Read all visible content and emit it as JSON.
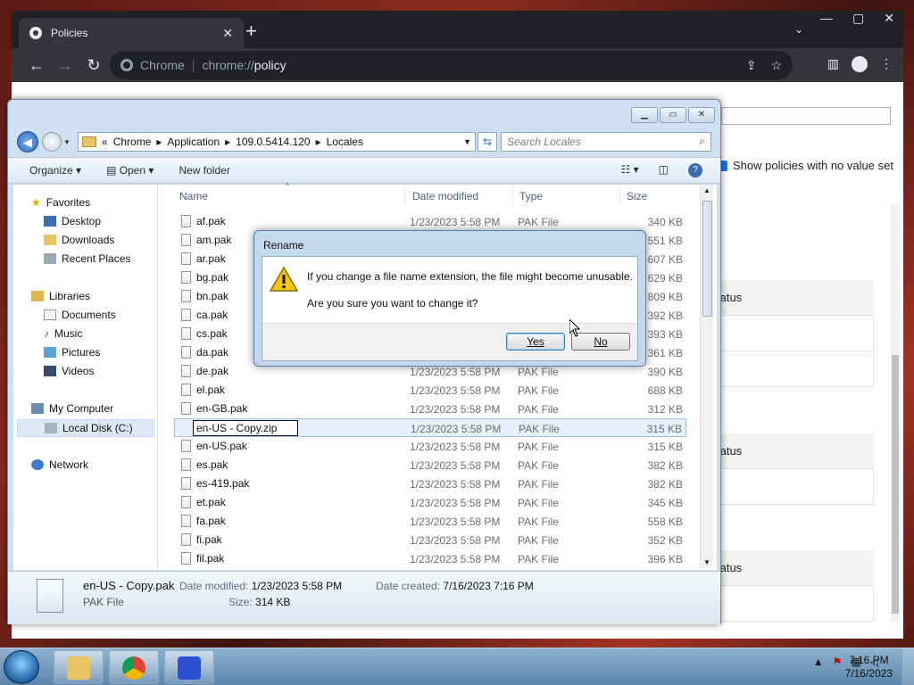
{
  "chrome": {
    "tab_title": "Policies",
    "tab_close": "✕",
    "new_tab": "+",
    "chip": "Chrome",
    "url_prefix": "chrome://",
    "url_path": "policy",
    "show_policies_label": "Show policies with no value set",
    "status_labels": [
      "tatus",
      "tatus",
      "tatus"
    ]
  },
  "explorer": {
    "breadcrumb": [
      "«",
      "Chrome",
      "Application",
      "109.0.5414.120",
      "Locales"
    ],
    "search_placeholder": "Search Locales",
    "commands": {
      "organize": "Organize ▾",
      "open": "Open ▾",
      "new_folder": "New folder"
    },
    "nav": {
      "favorites": "Favorites",
      "desktop": "Desktop",
      "downloads": "Downloads",
      "recent_places": "Recent Places",
      "libraries": "Libraries",
      "documents": "Documents",
      "music": "Music",
      "pictures": "Pictures",
      "videos": "Videos",
      "my_computer": "My Computer",
      "local_disk": "Local Disk (C:)",
      "network": "Network"
    },
    "columns": {
      "name": "Name",
      "date": "Date modified",
      "type": "Type",
      "size": "Size"
    },
    "files": [
      {
        "name": "af.pak",
        "date": "1/23/2023 5:58 PM",
        "type": "PAK File",
        "size": "340 KB"
      },
      {
        "name": "am.pak",
        "date": "",
        "type": "",
        "size": "551 KB"
      },
      {
        "name": "ar.pak",
        "date": "",
        "type": "",
        "size": "607 KB"
      },
      {
        "name": "bg.pak",
        "date": "",
        "type": "",
        "size": "629 KB"
      },
      {
        "name": "bn.pak",
        "date": "",
        "type": "",
        "size": "809 KB"
      },
      {
        "name": "ca.pak",
        "date": "",
        "type": "",
        "size": "392 KB"
      },
      {
        "name": "cs.pak",
        "date": "",
        "type": "",
        "size": "393 KB"
      },
      {
        "name": "da.pak",
        "date": "",
        "type": "",
        "size": "361 KB"
      },
      {
        "name": "de.pak",
        "date": "1/23/2023 5:58 PM",
        "type": "PAK File",
        "size": "390 KB"
      },
      {
        "name": "el.pak",
        "date": "1/23/2023 5:58 PM",
        "type": "PAK File",
        "size": "688 KB"
      },
      {
        "name": "en-GB.pak",
        "date": "1/23/2023 5:58 PM",
        "type": "PAK File",
        "size": "312 KB"
      },
      {
        "name": "en-US - Copy.zip",
        "date": "1/23/2023 5:58 PM",
        "type": "PAK File",
        "size": "315 KB"
      },
      {
        "name": "en-US.pak",
        "date": "1/23/2023 5:58 PM",
        "type": "PAK File",
        "size": "315 KB"
      },
      {
        "name": "es.pak",
        "date": "1/23/2023 5:58 PM",
        "type": "PAK File",
        "size": "382 KB"
      },
      {
        "name": "es-419.pak",
        "date": "1/23/2023 5:58 PM",
        "type": "PAK File",
        "size": "382 KB"
      },
      {
        "name": "et.pak",
        "date": "1/23/2023 5:58 PM",
        "type": "PAK File",
        "size": "345 KB"
      },
      {
        "name": "fa.pak",
        "date": "1/23/2023 5:58 PM",
        "type": "PAK File",
        "size": "558 KB"
      },
      {
        "name": "fi.pak",
        "date": "1/23/2023 5:58 PM",
        "type": "PAK File",
        "size": "352 KB"
      },
      {
        "name": "fil.pak",
        "date": "1/23/2023 5:58 PM",
        "type": "PAK File",
        "size": "396 KB"
      }
    ],
    "details": {
      "file_name": "en-US - Copy.pak",
      "file_type": "PAK File",
      "date_modified_label": "Date modified:",
      "date_modified": "1/23/2023 5:58 PM",
      "date_created_label": "Date created:",
      "date_created": "7/16/2023 7:16 PM",
      "size_label": "Size:",
      "size": "314 KB"
    }
  },
  "dialog": {
    "title": "Rename",
    "message1": "If you change a file name extension, the file might become unusable.",
    "message2": "Are you sure you want to change it?",
    "yes": "Yes",
    "no": "No"
  },
  "taskbar": {
    "time": "7:16 PM",
    "date": "7/16/2023"
  },
  "colors": {
    "chrome_dark": "#202124",
    "explorer_frame": "#cfe0f2",
    "selection": "#e5f0fb",
    "taskbar": "#5d86ad"
  }
}
